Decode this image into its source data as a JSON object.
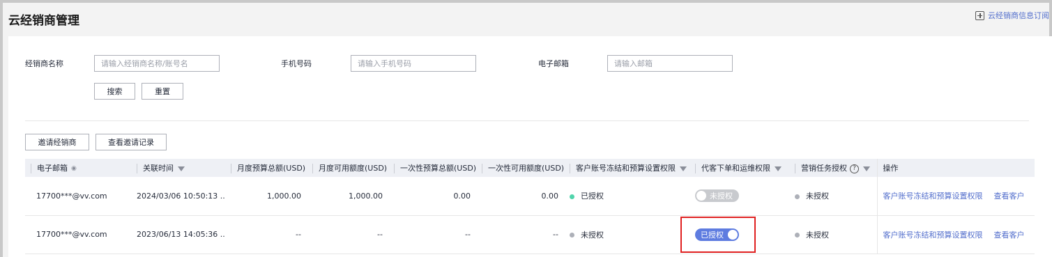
{
  "page": {
    "title": "云经销商管理",
    "subscribe_label": "云经销商信息订阅"
  },
  "filters": {
    "name_label": "经销商名称",
    "name_placeholder": "请输入经销商名称/账号名",
    "phone_label": "手机号码",
    "phone_placeholder": "请输入手机号码",
    "email_label": "电子邮箱",
    "email_placeholder": "请输入邮箱",
    "search_label": "搜索",
    "reset_label": "重置"
  },
  "actions": {
    "invite_label": "邀请经销商",
    "history_label": "查看邀请记录"
  },
  "table": {
    "headers": {
      "email": "电子邮箱",
      "linked_time": "关联时间",
      "monthly_budget": "月度预算总额(USD)",
      "monthly_available": "月度可用额度(USD)",
      "onetime_budget": "一次性预算总额(USD)",
      "onetime_available": "一次性可用额度(USD)",
      "freeze_permission": "客户账号冻结和预算设置权限",
      "order_permission": "代客下单和运维权限",
      "marketing_auth": "营销任务授权",
      "operations": "操作"
    },
    "rows": [
      {
        "email": "17700***@vv.com",
        "linked_time": "2024/03/06 10:50:13 ...",
        "monthly_budget": "1,000.00",
        "monthly_available": "1,000.00",
        "onetime_budget": "0.00",
        "onetime_available": "0.00",
        "freeze_status": "已授权",
        "order_toggle": "未授权",
        "marketing_status": "未授权",
        "op1": "客户账号冻结和预算设置权限",
        "op2": "查看客户"
      },
      {
        "email": "17700***@vv.com",
        "linked_time": "2023/06/13 14:05:36 ...",
        "monthly_budget": "--",
        "monthly_available": "--",
        "onetime_budget": "--",
        "onetime_available": "--",
        "freeze_status": "未授权",
        "order_toggle": "已授权",
        "marketing_status": "未授权",
        "op1": "客户账号冻结和预算设置权限",
        "op2": "查看客户"
      }
    ]
  },
  "colors": {
    "accent": "#5e7ce0",
    "link": "#526ecc",
    "authorized_dot": "#50d4ab",
    "unauthorized_dot": "#adb0b8",
    "highlight_box": "#e02020"
  },
  "icons": [
    "subscribe-icon",
    "eye-icon",
    "filter-icon",
    "help-icon"
  ]
}
